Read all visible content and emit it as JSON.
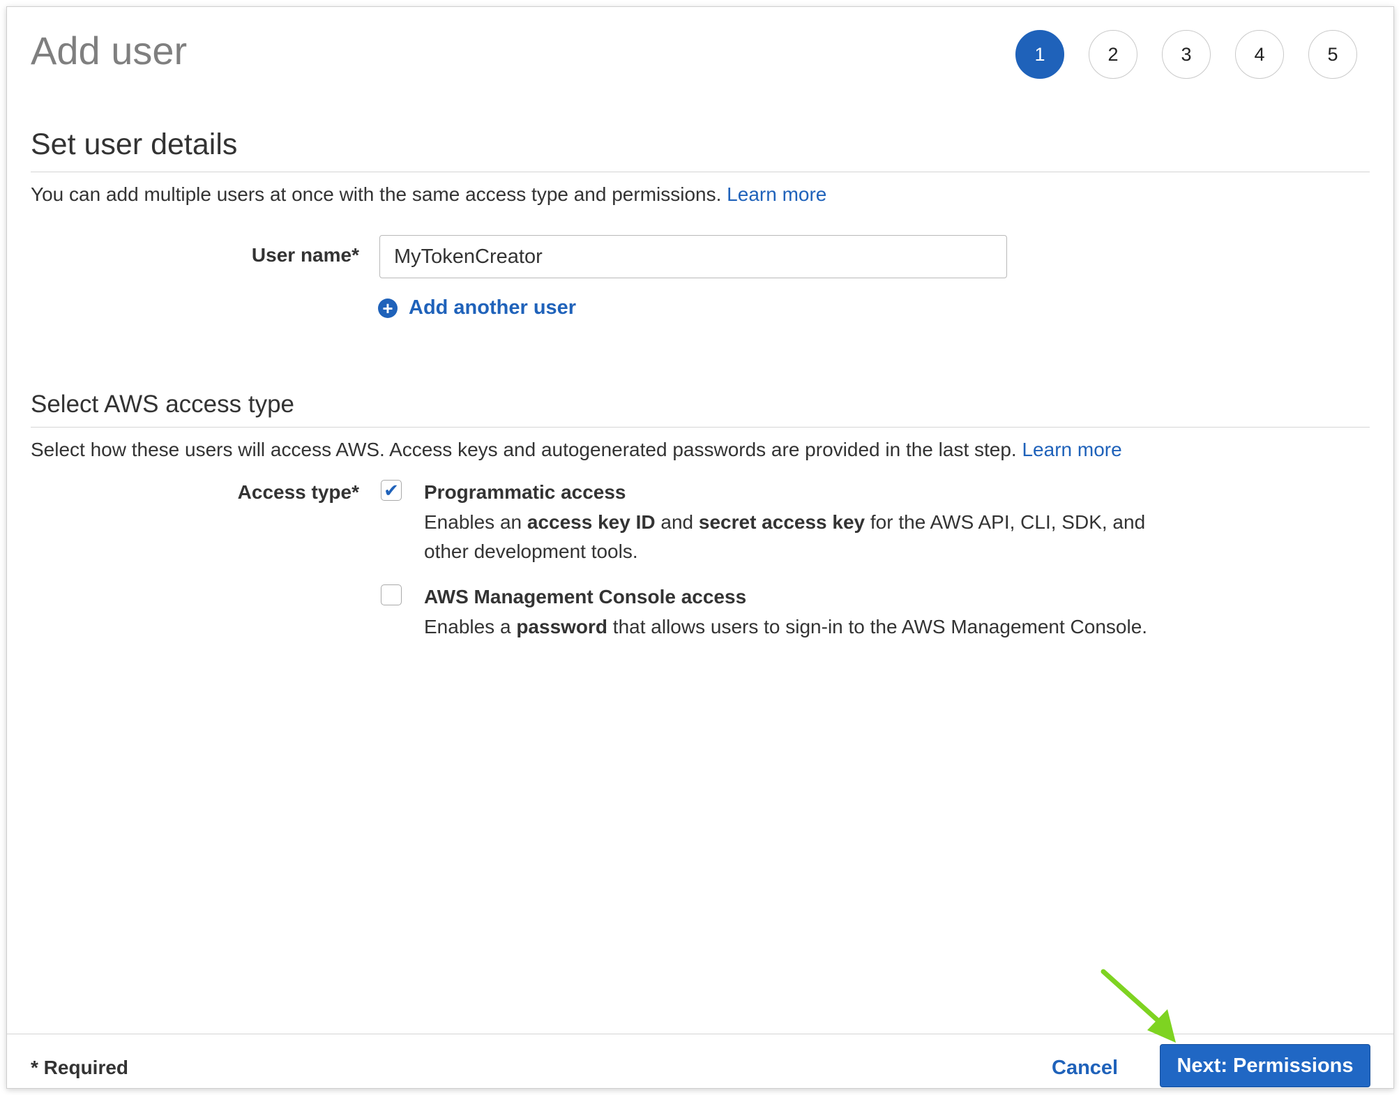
{
  "header": {
    "title": "Add user",
    "steps": [
      "1",
      "2",
      "3",
      "4",
      "5"
    ],
    "active_step": "1"
  },
  "user_details": {
    "heading": "Set user details",
    "description": "You can add multiple users at once with the same access type and permissions.",
    "learn_more": "Learn more",
    "user_name_label": "User name*",
    "user_name_value": "MyTokenCreator",
    "add_another_user": "Add another user"
  },
  "access_type": {
    "heading": "Select AWS access type",
    "description": "Select how these users will access AWS. Access keys and autogenerated passwords are provided in the last step.",
    "learn_more": "Learn more",
    "label": "Access type*",
    "options": [
      {
        "title": "Programmatic access",
        "checked": true,
        "desc_parts": [
          "Enables an ",
          "access key ID",
          " and ",
          "secret access key",
          " for the AWS API, CLI, SDK, and other development tools."
        ]
      },
      {
        "title": "AWS Management Console access",
        "checked": false,
        "desc_parts": [
          "Enables a ",
          "password",
          " that allows users to sign-in to the AWS Management Console."
        ]
      }
    ]
  },
  "footer": {
    "required": "* Required",
    "cancel": "Cancel",
    "next": "Next: Permissions"
  },
  "colors": {
    "accent": "#1f62ba",
    "annotation_arrow": "#7ed321"
  },
  "icons": {
    "add": "plus-circle-icon",
    "check": "checkmark-icon",
    "annotation": "arrow-annotation-icon"
  }
}
